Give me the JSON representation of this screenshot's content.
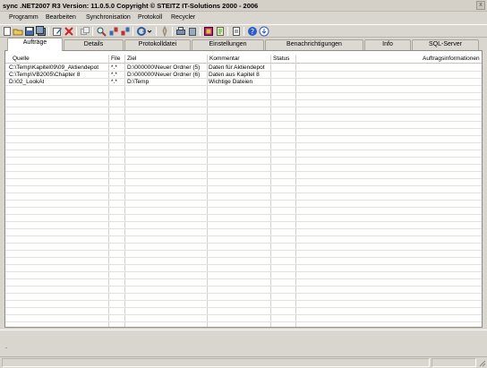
{
  "window": {
    "title": "sync .NET2007 R3  Version:  11.0.5.0    Copyright © STEITZ IT-Solutions 2000 - 2006",
    "close_glyph": "x"
  },
  "menu": [
    "Programm",
    "Bearbeiten",
    "Synchronisation",
    "Protokoll",
    "Recycler"
  ],
  "toolbar": [
    "new-icon",
    "open-icon",
    "save-icon",
    "save-all-icon",
    "edit-icon",
    "delete-icon",
    "copy-icon",
    "find-icon",
    "sync-icon",
    "sync-settings-icon",
    "undo-icon",
    "disk-icon",
    "print-icon",
    "recycle-icon",
    "spreadsheet-icon",
    "log-icon",
    "help-icon",
    "download-icon"
  ],
  "tabs": [
    {
      "label": "Aufträge",
      "active": true
    },
    {
      "label": "Details",
      "active": false
    },
    {
      "label": "Protokolldatei",
      "active": false
    },
    {
      "label": "Einstellungen",
      "active": false
    },
    {
      "label": "Benachrichtigungen",
      "active": false
    },
    {
      "label": "Info",
      "active": false
    },
    {
      "label": "SQL-Server",
      "active": false
    }
  ],
  "grid": {
    "columns": [
      "Quelle",
      "File",
      "Ziel",
      "Kommentar",
      "Status",
      "Auftragsinformationen"
    ],
    "rows": [
      [
        "C:\\Temp\\Kapitel09\\09_Aktiendepot",
        "*.*",
        "D:\\000000\\Neuer Ordner (5)",
        "Daten für Aktiendepot",
        "",
        ""
      ],
      [
        "C:\\Temp\\VB2005\\Chapter 8",
        "*.*",
        "D:\\000000\\Neuer Ordner (6)",
        "Daten aus Kapitel 8",
        "",
        ""
      ],
      [
        "D:\\02_LookAt",
        "*.*",
        "D:\\Temp",
        "Wichtige Dateien",
        "",
        ""
      ]
    ]
  },
  "status": {
    "message": "."
  },
  "colors": {
    "window_bg": "#d9d6cf",
    "grid_bg": "#ffffff",
    "active_tab": "#ffffff"
  }
}
